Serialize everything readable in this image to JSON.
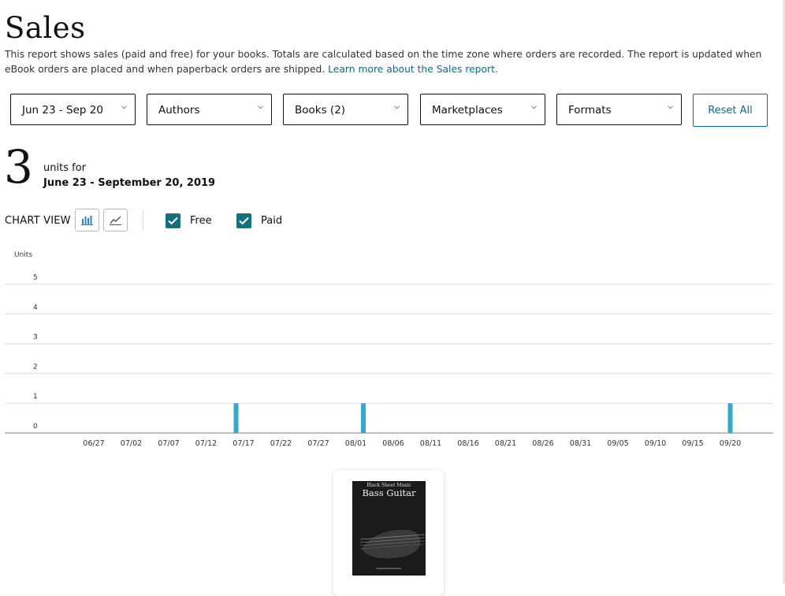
{
  "page": {
    "title": "Sales",
    "description": "This report shows sales (paid and free) for your books. Totals are calculated based on the time zone where orders are recorded. The report is updated when eBook orders are placed and when paperback orders are shipped.",
    "learn_more": "Learn more about the Sales report."
  },
  "filters": {
    "date": "Jun 23 - Sep 20",
    "authors": "Authors",
    "books": "Books (2)",
    "marketplaces": "Marketplaces",
    "formats": "Formats",
    "reset": "Reset All"
  },
  "summary": {
    "count": "3",
    "units_for": "units for",
    "range": "June 23 - September 20, 2019"
  },
  "chart_view": {
    "label": "CHART VIEW",
    "free_label": "Free",
    "paid_label": "Paid",
    "free_checked": true,
    "paid_checked": true
  },
  "book": {
    "cover_publisher": "Black Sheet Music",
    "cover_title": "Bass Guitar"
  },
  "colors": {
    "accent": "#13717f",
    "bar": "#35a8cb",
    "link": "#086e85"
  },
  "chart_data": {
    "type": "bar",
    "ylabel": "Units",
    "ylim": [
      0,
      5
    ],
    "yticks": [
      0,
      1,
      2,
      3,
      4,
      5
    ],
    "x_tick_labels": [
      "06/27",
      "07/02",
      "07/07",
      "07/12",
      "07/17",
      "07/22",
      "07/27",
      "08/01",
      "08/06",
      "08/11",
      "08/16",
      "08/21",
      "08/26",
      "08/31",
      "09/05",
      "09/10",
      "09/15",
      "09/20"
    ],
    "categories": [
      "07/16",
      "08/02",
      "09/20"
    ],
    "values": [
      1,
      1,
      1
    ]
  }
}
